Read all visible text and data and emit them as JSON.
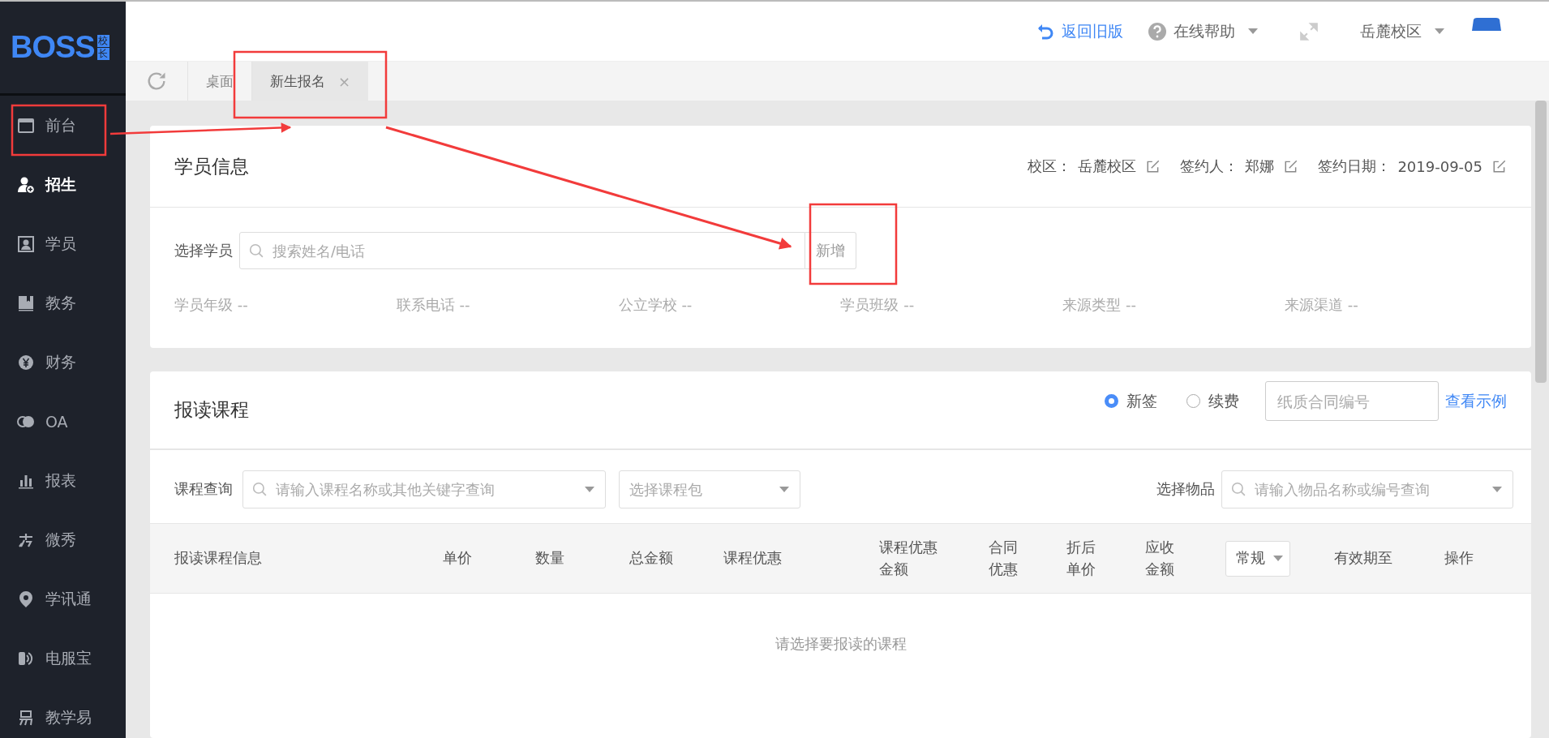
{
  "logo": {
    "text": "BOSS",
    "badge": [
      "校",
      "长"
    ]
  },
  "sidebar": {
    "items": [
      {
        "label": "前台",
        "selected": false
      },
      {
        "label": "招生",
        "selected": true
      },
      {
        "label": "学员",
        "selected": false
      },
      {
        "label": "教务",
        "selected": false
      },
      {
        "label": "财务",
        "selected": false
      },
      {
        "label": "OA",
        "selected": false
      },
      {
        "label": "报表",
        "selected": false
      },
      {
        "label": "微秀",
        "selected": false
      },
      {
        "label": "学讯通",
        "selected": false
      },
      {
        "label": "电服宝",
        "selected": false
      },
      {
        "label": "教学易",
        "selected": false
      }
    ]
  },
  "topbar": {
    "back": "返回旧版",
    "help": "在线帮助",
    "campus": "岳麓校区"
  },
  "tabs": [
    {
      "label": "桌面",
      "selected": false
    },
    {
      "label": "新生报名",
      "selected": true,
      "close": "×"
    }
  ],
  "student_card": {
    "title": "学员信息",
    "meta": [
      {
        "label": "校区：",
        "value": "岳麓校区"
      },
      {
        "label": "签约人：",
        "value": "郑娜"
      },
      {
        "label": "签约日期：",
        "value": "2019-09-05"
      }
    ],
    "select_label": "选择学员",
    "search": {
      "placeholder": "搜索姓名/电话"
    },
    "add_button": "新增",
    "fields": [
      {
        "label": "学员年级",
        "value": "--"
      },
      {
        "label": "联系电话",
        "value": "--"
      },
      {
        "label": "公立学校",
        "value": "--"
      },
      {
        "label": "学员班级",
        "value": "--"
      },
      {
        "label": "来源类型",
        "value": "--"
      },
      {
        "label": "来源渠道",
        "value": "--"
      }
    ]
  },
  "course_card": {
    "title": "报读课程",
    "radios": [
      {
        "label": "新签",
        "selected": true
      },
      {
        "label": "续费",
        "selected": false
      }
    ],
    "contract": {
      "placeholder": "纸质合同编号"
    },
    "example_link": "查看示例",
    "query_label": "课程查询",
    "query": {
      "placeholder": "请输入课程名称或其他关键字查询"
    },
    "package": {
      "placeholder": "选择课程包"
    },
    "goods_label": "选择物品",
    "goods": {
      "placeholder": "请输入物品名称或编号查询"
    },
    "table": {
      "columns": [
        {
          "kind": "text",
          "label": [
            "报读课程信息"
          ]
        },
        {
          "kind": "text",
          "label": [
            "单价"
          ]
        },
        {
          "kind": "text",
          "label": [
            "数量"
          ]
        },
        {
          "kind": "text",
          "label": [
            "总金额"
          ]
        },
        {
          "kind": "text",
          "label": [
            "课程优惠"
          ]
        },
        {
          "kind": "text",
          "label": [
            "课程优惠",
            "金额"
          ]
        },
        {
          "kind": "text",
          "label": [
            "合同",
            "优惠"
          ]
        },
        {
          "kind": "text",
          "label": [
            "折后",
            "单价"
          ]
        },
        {
          "kind": "text",
          "label": [
            "应收",
            "金额"
          ]
        },
        {
          "kind": "select",
          "label": [
            "常规"
          ]
        },
        {
          "kind": "text",
          "label": [
            "有效期至"
          ]
        },
        {
          "kind": "text",
          "label": [
            "操作"
          ]
        }
      ],
      "empty": "请选择要报读的课程"
    }
  }
}
